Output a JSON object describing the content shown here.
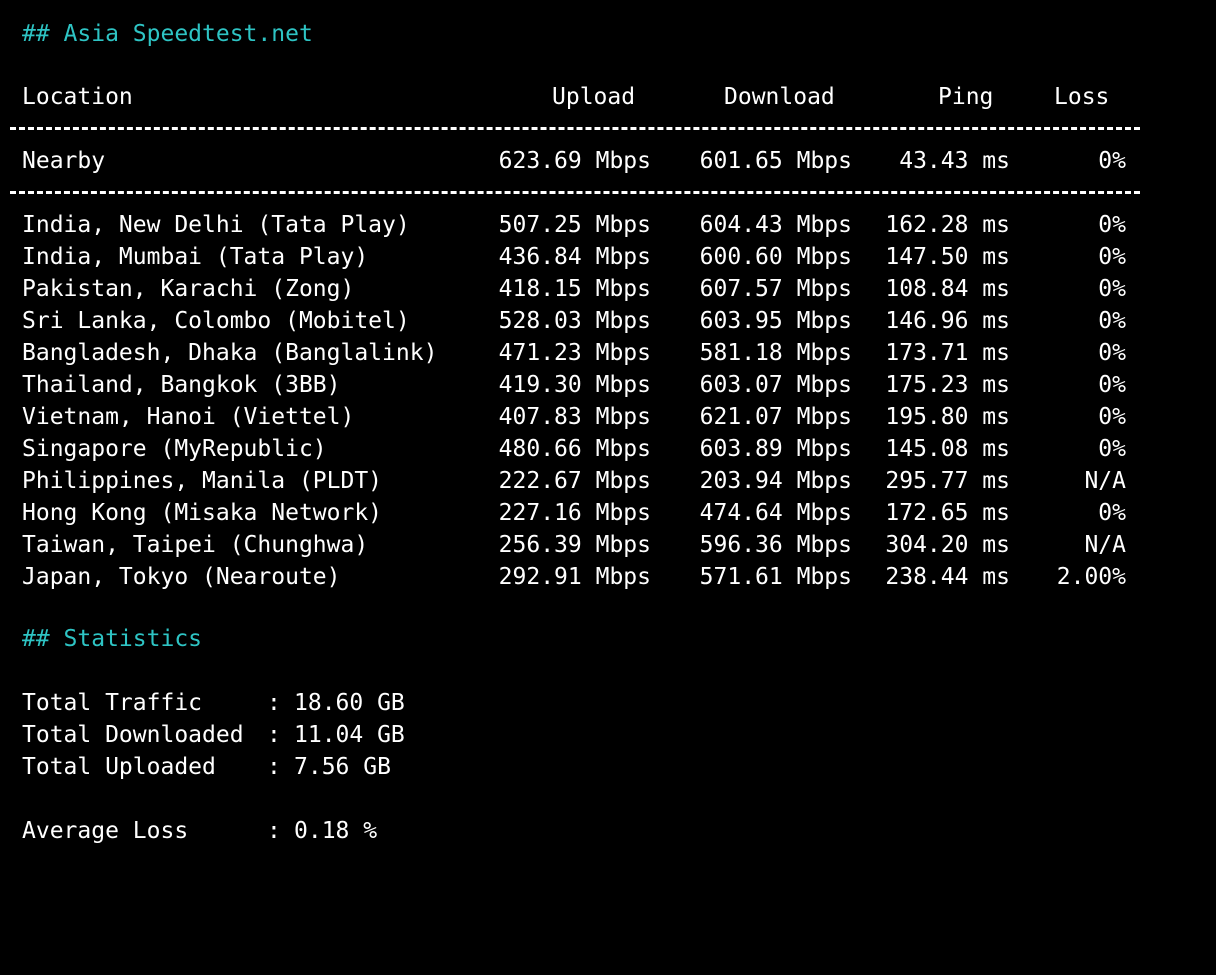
{
  "asia_heading": "## Asia Speedtest.net",
  "columns": {
    "location": "Location",
    "upload": "Upload",
    "download": "Download",
    "ping": "Ping",
    "loss": "Loss"
  },
  "nearby": {
    "location": "Nearby",
    "upload": "623.69 Mbps",
    "download": "601.65 Mbps",
    "ping": "43.43 ms",
    "loss": "0%"
  },
  "rows": [
    {
      "location": "India, New Delhi (Tata Play)",
      "upload": "507.25 Mbps",
      "download": "604.43 Mbps",
      "ping": "162.28 ms",
      "loss": "0%"
    },
    {
      "location": "India, Mumbai (Tata Play)",
      "upload": "436.84 Mbps",
      "download": "600.60 Mbps",
      "ping": "147.50 ms",
      "loss": "0%"
    },
    {
      "location": "Pakistan, Karachi (Zong)",
      "upload": "418.15 Mbps",
      "download": "607.57 Mbps",
      "ping": "108.84 ms",
      "loss": "0%"
    },
    {
      "location": "Sri Lanka, Colombo (Mobitel)",
      "upload": "528.03 Mbps",
      "download": "603.95 Mbps",
      "ping": "146.96 ms",
      "loss": "0%"
    },
    {
      "location": "Bangladesh, Dhaka (Banglalink)",
      "upload": "471.23 Mbps",
      "download": "581.18 Mbps",
      "ping": "173.71 ms",
      "loss": "0%"
    },
    {
      "location": "Thailand, Bangkok (3BB)",
      "upload": "419.30 Mbps",
      "download": "603.07 Mbps",
      "ping": "175.23 ms",
      "loss": "0%"
    },
    {
      "location": "Vietnam, Hanoi (Viettel)",
      "upload": "407.83 Mbps",
      "download": "621.07 Mbps",
      "ping": "195.80 ms",
      "loss": "0%"
    },
    {
      "location": "Singapore (MyRepublic)",
      "upload": "480.66 Mbps",
      "download": "603.89 Mbps",
      "ping": "145.08 ms",
      "loss": "0%"
    },
    {
      "location": "Philippines, Manila (PLDT)",
      "upload": "222.67 Mbps",
      "download": "203.94 Mbps",
      "ping": "295.77 ms",
      "loss": "N/A"
    },
    {
      "location": "Hong Kong (Misaka Network)",
      "upload": "227.16 Mbps",
      "download": "474.64 Mbps",
      "ping": "172.65 ms",
      "loss": "0%"
    },
    {
      "location": "Taiwan, Taipei (Chunghwa)",
      "upload": "256.39 Mbps",
      "download": "596.36 Mbps",
      "ping": "304.20 ms",
      "loss": "N/A"
    },
    {
      "location": "Japan, Tokyo (Nearoute)",
      "upload": "292.91 Mbps",
      "download": "571.61 Mbps",
      "ping": "238.44 ms",
      "loss": "2.00%"
    }
  ],
  "stats_heading": "## Statistics",
  "stats": [
    {
      "label": "Total Traffic",
      "colon": ":",
      "value": "18.60 GB"
    },
    {
      "label": "Total Downloaded",
      "colon": ":",
      "value": "11.04 GB"
    },
    {
      "label": "Total Uploaded",
      "colon": ":",
      "value": "7.56 GB"
    }
  ],
  "average_loss": {
    "label": "Average Loss",
    "colon": ":",
    "value": "0.18 %"
  },
  "colors": {
    "background": "#000000",
    "text": "#ffffff",
    "heading": "#2ec4c4"
  }
}
